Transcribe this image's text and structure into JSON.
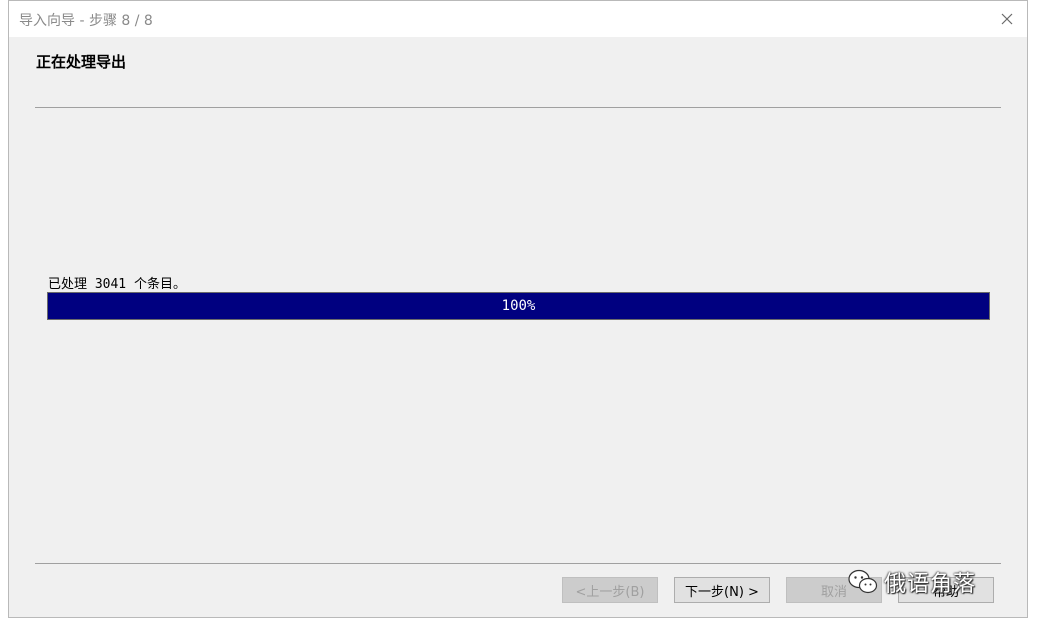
{
  "window": {
    "title": "导入向导 - 步骤 8 / 8"
  },
  "page": {
    "heading": "正在处理导出",
    "status_text": "已处理 3041 个条目。"
  },
  "progress": {
    "value_percent": 100,
    "label": "100%"
  },
  "buttons": {
    "back": "<上一步(B)",
    "next": "下一步(N) >",
    "cancel": "取消",
    "help": "帮助"
  },
  "watermark": {
    "text": "俄语角落",
    "icon": "wechat-icon"
  },
  "icons": {
    "close": "close-icon"
  },
  "colors": {
    "progress_fill": "#000080",
    "window_bg": "#f0f0f0",
    "title_text": "#8a8a8a"
  }
}
